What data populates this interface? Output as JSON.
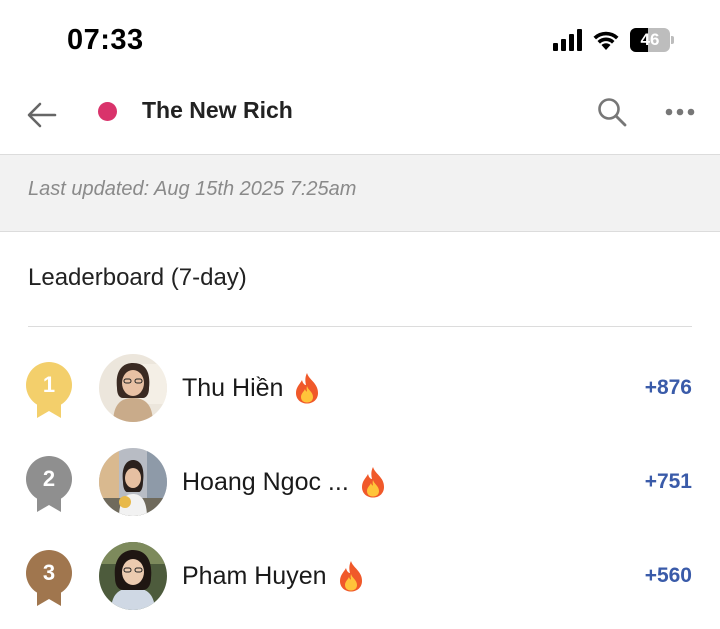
{
  "status_bar": {
    "time": "07:33",
    "battery_level": "46",
    "signal_bars": 4
  },
  "header": {
    "back_icon": "arrow-left-icon",
    "group_name": "The New Rich",
    "group_dot_color": "#d9336b",
    "search_icon": "search-icon",
    "more_icon": "more-horizontal-icon"
  },
  "banner": {
    "last_updated": "Last updated: Aug 15th 2025 7:25am"
  },
  "leaderboard": {
    "title": "Leaderboard (7-day)",
    "entries": [
      {
        "rank": "1",
        "name": "Thu Hiền",
        "points": "+876",
        "badge_color": "#f3cf6b",
        "streak_icon": "fire-icon"
      },
      {
        "rank": "2",
        "name": "Hoang Ngoc ...",
        "points": "+751",
        "badge_color": "#8f8f8f",
        "streak_icon": "fire-icon"
      },
      {
        "rank": "3",
        "name": "Pham Huyen",
        "points": "+560",
        "badge_color": "#a0764e",
        "streak_icon": "fire-icon"
      }
    ]
  },
  "colors": {
    "points": "#3a5ba9",
    "banner_bg": "#f2f2f2"
  }
}
